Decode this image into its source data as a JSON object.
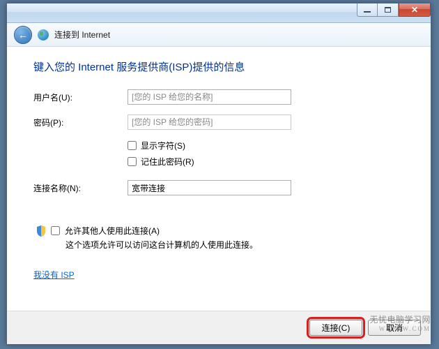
{
  "window": {
    "header_title": "连接到 Internet"
  },
  "content": {
    "heading": "键入您的 Internet 服务提供商(ISP)提供的信息",
    "username_label": "用户名(U):",
    "username_placeholder": "[您的 ISP 给您的名称]",
    "password_label": "密码(P):",
    "password_placeholder": "[您的 ISP 给您的密码]",
    "show_chars_label": "显示字符(S)",
    "remember_pwd_label": "记住此密码(R)",
    "conn_name_label": "连接名称(N):",
    "conn_name_value": "宽带连接",
    "allow_others_label": "允许其他人使用此连接(A)",
    "allow_others_desc": "这个选项允许可以访问这台计算机的人使用此连接。",
    "no_isp_link": "我没有 ISP"
  },
  "footer": {
    "connect_label": "连接(C)",
    "cancel_label": "取消"
  },
  "watermark": {
    "line1": "无忧电脑学习网",
    "line2": "WYPCW.COM"
  }
}
